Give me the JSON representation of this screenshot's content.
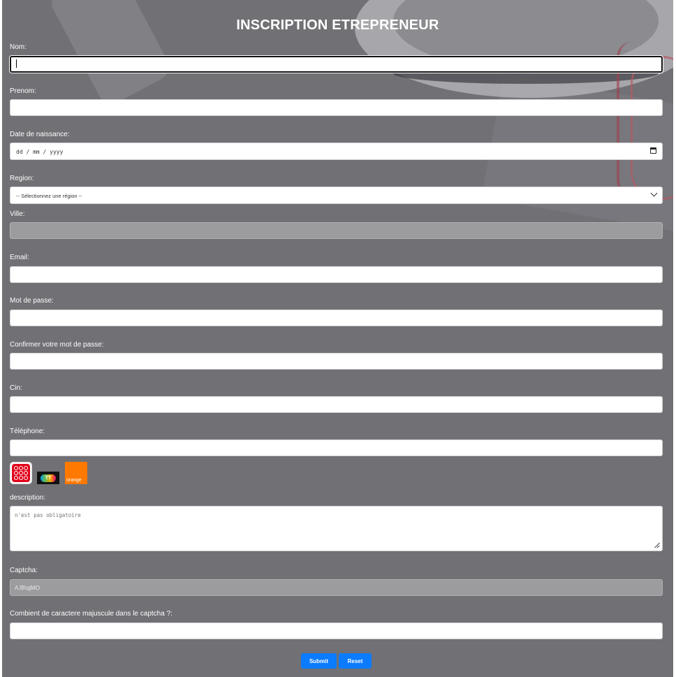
{
  "title": "INSCRIPTION ETREPRENEUR",
  "fields": {
    "nom": {
      "label": "Nom:",
      "value": ""
    },
    "prenom": {
      "label": "Prenom:",
      "value": ""
    },
    "date_naissance": {
      "label": "Date de naissance:",
      "placeholder": "dd / mm / yyyy"
    },
    "region": {
      "label": "Region:",
      "selected": "-- Sélectionnez une région --"
    },
    "ville": {
      "label": "Ville:",
      "value": ""
    },
    "email": {
      "label": "Email:",
      "value": ""
    },
    "mot_de_passe": {
      "label": "Mot de passe:",
      "value": ""
    },
    "confirmer": {
      "label": "Confirmer votre mot de passe:",
      "value": ""
    },
    "cin": {
      "label": "Cin:",
      "value": ""
    },
    "telephone": {
      "label": "Téléphone:",
      "value": ""
    },
    "description": {
      "label": "description:",
      "placeholder": "n'est pas obligatoire"
    },
    "captcha": {
      "label": "Captcha:",
      "value": "AJB\\qjMO"
    },
    "majuscules": {
      "label": "Combient de caractere majuscule dans le captcha ?:",
      "value": ""
    }
  },
  "operators": [
    {
      "name": "ooredoo",
      "icon": "ooredoo-logo-icon"
    },
    {
      "name": "tt",
      "icon": "tunisie-telecom-logo-icon",
      "text": "TT"
    },
    {
      "name": "orange",
      "icon": "orange-logo-icon",
      "text": "orange"
    }
  ],
  "buttons": {
    "submit": "Submit",
    "reset": "Reset"
  },
  "colors": {
    "button": "#0b7bff",
    "overlay": "#707075",
    "orange": "#ff7900",
    "ooredoo": "#e2001a"
  }
}
